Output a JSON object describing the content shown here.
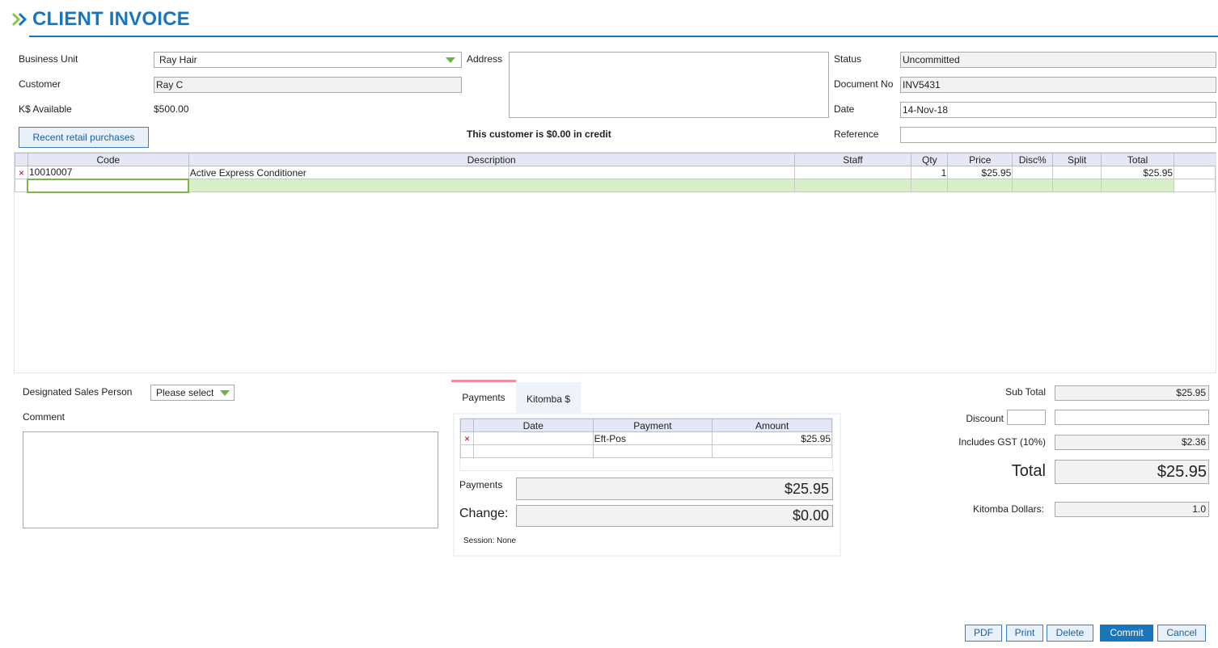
{
  "header": {
    "title": "CLIENT INVOICE"
  },
  "form": {
    "business_unit": {
      "label": "Business Unit",
      "value": "Ray Hair"
    },
    "customer": {
      "label": "Customer",
      "value": "Ray C"
    },
    "ks_available": {
      "label": "K$ Available",
      "value": "$500.00"
    },
    "recent_button": "Recent retail purchases",
    "address": {
      "label": "Address",
      "value": ""
    },
    "credit_message": "This customer is $0.00 in credit",
    "status": {
      "label": "Status",
      "value": "Uncommitted"
    },
    "document_no": {
      "label": "Document No",
      "value": "INV5431"
    },
    "date": {
      "label": "Date",
      "value": "14-Nov-18"
    },
    "reference": {
      "label": "Reference",
      "value": ""
    }
  },
  "items": {
    "columns": [
      "Code",
      "Description",
      "Staff",
      "Qty",
      "Price",
      "Disc%",
      "Split",
      "Total"
    ],
    "rows": [
      {
        "code": "10010007",
        "description": "Active Express Conditioner",
        "staff": "",
        "qty": "1",
        "price": "$25.95",
        "disc": "",
        "split": "",
        "total": "$25.95",
        "delete_glyph": "×"
      }
    ]
  },
  "sales": {
    "designated_label": "Designated Sales Person",
    "designated_value": "Please select",
    "comment_label": "Comment",
    "comment_value": ""
  },
  "payments": {
    "tabs": [
      "Payments",
      "Kitomba $"
    ],
    "columns": [
      "Date",
      "Payment",
      "Amount"
    ],
    "rows": [
      {
        "date": "",
        "payment": "Eft-Pos",
        "amount": "$25.95",
        "delete_glyph": "×"
      }
    ],
    "payments_label": "Payments",
    "payments_value": "$25.95",
    "change_label": "Change:",
    "change_value": "$0.00",
    "session": "Session: None"
  },
  "totals": {
    "sub_total_label": "Sub Total",
    "sub_total": "$25.95",
    "discount_label": "Discount",
    "discount_pct": "",
    "discount_value": "",
    "gst_label": "Includes GST (10%)",
    "gst": "$2.36",
    "total_label": "Total",
    "total": "$25.95",
    "kitomba_label": "Kitomba Dollars:",
    "kitomba": "1.0"
  },
  "actions": {
    "pdf": "PDF",
    "print": "Print",
    "delete": "Delete",
    "commit": "Commit",
    "cancel": "Cancel"
  },
  "colors": {
    "accent": "#1a75bb",
    "green": "#6cb33f",
    "tab_highlight": "#f28b9a",
    "delete_x": "#d0021b"
  }
}
